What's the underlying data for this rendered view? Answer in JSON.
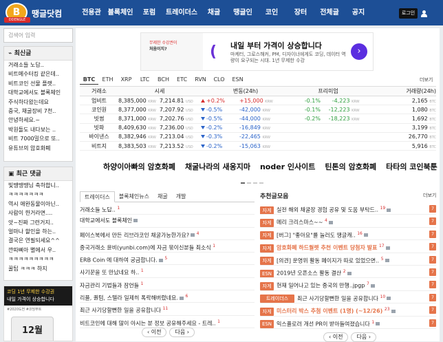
{
  "header": {
    "logo_mark": "B",
    "logo_sub": "DDENGLE",
    "logo_text": "땡글닷컴",
    "nav": [
      "전용관",
      "블록체인",
      "포럼",
      "트레이더스",
      "채굴",
      "땡글인",
      "코인",
      "장터",
      "전체글",
      "공지"
    ],
    "login_label": "로그인"
  },
  "sidebar": {
    "search_placeholder": "검색어 입력",
    "latest_title": "최신글",
    "latest": [
      "거래소들 노답..",
      "비트메수터킹 같은데..",
      "비트코인 선물 플랫..",
      "대학교에서도 블록체인",
      "주식하다왔는데요",
      "중국, 채굴장비 7천..",
      "안녕하세요.~",
      "박원돌도 내다보는 ..",
      "비트 7000밀으로 또..",
      "유튜브의 암호화폐"
    ],
    "comments_title": "최근 댓글",
    "comments": [
      "빛땡땡땡님 축하합니..",
      "ㅋㅋㅋㅋㅋㅋㅋ",
      "역시 애완동물이아닌..",
      "사람이 한거라면....",
      "앗~진짜 그런거지..",
      "얼마나 할인을 하는..",
      "결국은 연필되세요^^",
      "깐따삐아 별에서 우..",
      "ㅋㅋㅋㅋㅋㅋㅋㅋㅋ",
      "꿀팁 ㅋㅋㅋ 하지"
    ],
    "promo_line1": "코딩 1년 무제한 수강권",
    "promo_line2": "내일 가격이 상승합니다",
    "promo_tag": "#2020도전 #코딩부트",
    "promo_price": "12월"
  },
  "ad": {
    "logo_line1": "무제한 수강권이",
    "logo_line2": "처음이지?",
    "title": "내일 부터 가격이 상승합니다",
    "desc": "마케터, 그로스해커, PM, 디자이너에게도 코딩, 데이터 역량이 요구되는 시대. 1년 무제한 수강",
    "arrow": "›",
    "brand_color": "#5b2ee0"
  },
  "quotes": {
    "tabs": [
      "BTC",
      "ETH",
      "XRP",
      "LTC",
      "BCH",
      "ETC",
      "RVN",
      "CLO",
      "ESN"
    ],
    "more": "더보기",
    "headers": [
      "거래소",
      "시세",
      "변동(24h)",
      "프리미엄",
      "거래량(24h)"
    ],
    "rows": [
      {
        "ex": "업비트",
        "krw": "8,385,000",
        "usd": "7,214.81",
        "chg_pct": "+0.2%",
        "chg_amt": "+15,000",
        "prem_pct": "-0.1%",
        "prem_amt": "-4,223",
        "vol": "2,165",
        "dir": "up"
      },
      {
        "ex": "코인원",
        "krw": "8,377,000",
        "usd": "7,207.92",
        "chg_pct": "-0.5%",
        "chg_amt": "-42,000",
        "prem_pct": "-0.1%",
        "prem_amt": "-12,223",
        "vol": "1,080",
        "dir": "dn"
      },
      {
        "ex": "빗썸",
        "krw": "8,371,000",
        "usd": "7,202.76",
        "chg_pct": "-0.5%",
        "chg_amt": "-44,000",
        "prem_pct": "-0.2%",
        "prem_amt": "-18,223",
        "vol": "1,692",
        "dir": "dn"
      },
      {
        "ex": "빗파",
        "krw": "8,409,630",
        "usd": "7,236.00",
        "chg_pct": "-0.2%",
        "chg_amt": "-16,849",
        "prem_pct": "",
        "prem_amt": "",
        "vol": "3,199",
        "dir": "dn"
      },
      {
        "ex": "바이낸스",
        "krw": "8,382,946",
        "usd": "7,213.04",
        "chg_pct": "-0.3%",
        "chg_amt": "-22,465",
        "prem_pct": "",
        "prem_amt": "",
        "vol": "26,770",
        "dir": "dn"
      },
      {
        "ex": "비트지",
        "krw": "8,383,503",
        "usd": "7,213.52",
        "chg_pct": "-0.2%",
        "chg_amt": "-15,063",
        "prem_pct": "",
        "prem_amt": "",
        "vol": "5,916",
        "dir": "dn"
      }
    ],
    "unit_krw": "KRW",
    "unit_usd": "USD",
    "unit_btc": "BTC"
  },
  "banners": [
    "하양이아빠의 암호화폐",
    "채굴나라의 새옹지마",
    "noder 인사이트",
    "틴톤의 암호화폐",
    "타타의 코인북툰"
  ],
  "left_panel": {
    "tabs": [
      "트레이더스",
      "블록체인뉴스",
      "채굴",
      "개발"
    ],
    "posts": [
      {
        "t": "거래소들 노답..",
        "c": "1",
        "pic": false
      },
      {
        "t": "대학교에서도 블록체인",
        "c": "",
        "pic": true
      },
      {
        "t": "페이스북에서 만든 리브라코인 채굴가능한가요?",
        "c": "4",
        "pic": true
      },
      {
        "t": "중국거래소 윤비(yunbi.com)에 자금 묶이신분들 최소식",
        "c": "1",
        "pic": false
      },
      {
        "t": "ERB Coin 에 대하여 궁금합니다.",
        "c": "5",
        "pic": true
      },
      {
        "t": "사기꾼을 또 만났네요 하..",
        "c": "1",
        "pic": false
      },
      {
        "t": "자금관리 기법들과 잠언들",
        "c": "1",
        "pic": false
      },
      {
        "t": "리플, 퀀텀, 스텔라 일제히 폭락해버렸네요.",
        "c": "6",
        "pic": true
      },
      {
        "t": "최근 사기당할뻔한 일을 공유합니다",
        "c": "11",
        "pic": false
      },
      {
        "t": "비트코인에 대해 많이 아시는 분 정보 공유해주세요 - 트레..",
        "c": "1",
        "pic": false
      }
    ],
    "prev": "‹ 이전",
    "next": "다음 ›"
  },
  "right_panel": {
    "title": "추천글모음",
    "more": "더보기",
    "posts": [
      {
        "tag": "자게",
        "t": "실전 해외 채굴장 경험 공유 및 도움 부탁드..",
        "c": "19",
        "n": "7",
        "hl": false
      },
      {
        "tag": "자게",
        "t": "메리 크리스마스~~",
        "c": "4",
        "n": "7",
        "hl": false
      },
      {
        "tag": "자게",
        "t": "[버그] \"좋아요\"를 눌러도 땡글캐..",
        "c": "16",
        "n": "7",
        "hl": false
      },
      {
        "tag": "자게",
        "t": "암호화폐 하드월렛 추천 이벤트 당첨자 발표",
        "c": "17",
        "n": "7",
        "hl": true
      },
      {
        "tag": "자게",
        "t": "[의견] 운영위 활동 페이지가 따로 있었으면..",
        "c": "5",
        "n": "7",
        "hl": false
      },
      {
        "tag": "ESN",
        "t": "2019년 오픈소스 활동 결산",
        "c": "2",
        "n": "7",
        "hl": false
      },
      {
        "tag": "자게",
        "t": "현재 일어나고 있는 중국의 만행..jpgp",
        "c": "7",
        "n": "7",
        "hl": false
      },
      {
        "tag": "트레이더스",
        "t": "최근 사기당할뻔한 일을 공유합니다",
        "c": "10",
        "n": "7",
        "hl": false
      },
      {
        "tag": "자게",
        "t": "미스터리 박스 추첨 이벤트 (1명) (~12/26)",
        "c": "23",
        "n": "7",
        "hl": true
      },
      {
        "tag": "ESN",
        "t": "익스플로러 개선 PR이 받아들여졌습니다",
        "c": "1",
        "n": "7",
        "hl": false
      }
    ],
    "prev": "‹ 이전",
    "next": "다음 ›"
  }
}
